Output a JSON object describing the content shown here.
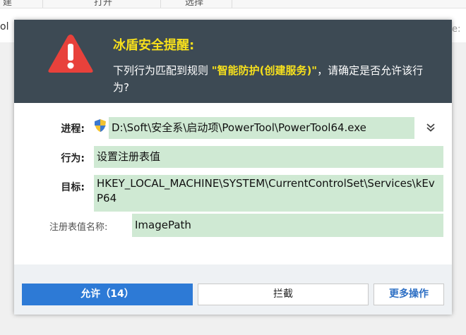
{
  "background": {
    "toolbar_items": [
      "建",
      "打开",
      "选择"
    ],
    "row_left_text": "ol",
    "row_right_text": "e:"
  },
  "dialog": {
    "title": "冰盾安全提醒:",
    "message_prefix": "下列行为匹配到规则 ",
    "rule_name": "\"智能防护(创建服务)\"",
    "message_suffix": "，请确定是否允许该行为?",
    "fields": {
      "process_label": "进程:",
      "process_value": "D:\\Soft\\安全系\\启动项\\PowerTool\\PowerTool64.exe",
      "action_label": "行为:",
      "action_value": "设置注册表值",
      "target_label": "目标:",
      "target_value": "HKEY_LOCAL_MACHINE\\SYSTEM\\CurrentControlSet\\Services\\kEvP64",
      "regname_label": "注册表值名称:",
      "regname_value": "ImagePath"
    },
    "buttons": {
      "allow": "允许（14）",
      "block": "拦截",
      "more": "更多操作"
    },
    "icons": {
      "warning": "warning-triangle-icon",
      "shield": "uac-shield-icon",
      "expand": "double-chevron-down-icon"
    },
    "colors": {
      "header_bg": "#3d4a54",
      "title": "#f7e01c",
      "field_bg": "#cfe9d3",
      "allow_button": "#2d7ad6",
      "warning_red": "#e8413b"
    }
  }
}
